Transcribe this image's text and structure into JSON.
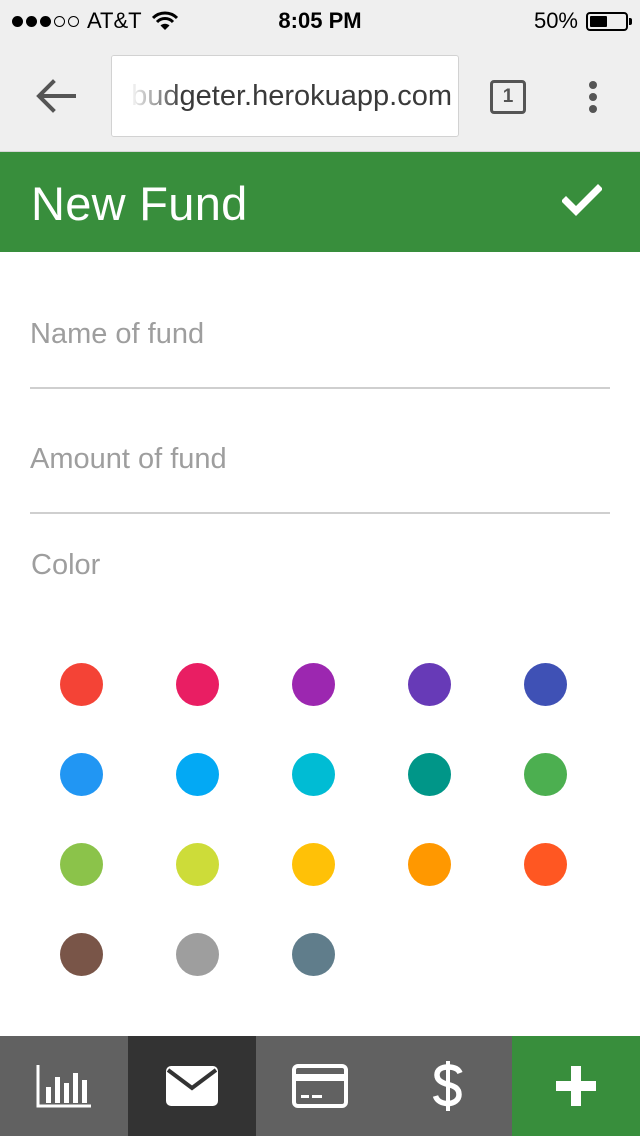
{
  "status_bar": {
    "carrier": "AT&T",
    "time": "8:05 PM",
    "battery": "50%",
    "battery_level": 0.5,
    "signal": {
      "filled": 3,
      "total": 5
    }
  },
  "browser": {
    "url": "budgeter.herokuapp.com",
    "tab_count": "1"
  },
  "header": {
    "title": "New Fund"
  },
  "form": {
    "name_placeholder": "Name of fund",
    "amount_placeholder": "Amount of fund",
    "color_label": "Color"
  },
  "colors": [
    "#f44336",
    "#e91e63",
    "#9c27b0",
    "#673ab7",
    "#3f51b5",
    "#2196f3",
    "#03a9f4",
    "#00bcd4",
    "#009688",
    "#4caf50",
    "#8bc34a",
    "#cddc39",
    "#ffc107",
    "#ff9800",
    "#ff5722",
    "#795548",
    "#9e9e9e",
    "#607d8b"
  ],
  "bottom_nav": [
    {
      "icon": "bar-chart-icon",
      "bg": "#616161",
      "active": false
    },
    {
      "icon": "envelope-icon",
      "bg": "#333333",
      "active": true
    },
    {
      "icon": "credit-card-icon",
      "bg": "#616161",
      "active": false
    },
    {
      "icon": "dollar-icon",
      "bg": "#616161",
      "active": false
    },
    {
      "icon": "plus-icon",
      "bg": "#388e3c",
      "active": false
    }
  ],
  "theme": {
    "primary": "#388e3c",
    "status_bg": "#efefef",
    "placeholder": "#9e9e9e"
  }
}
